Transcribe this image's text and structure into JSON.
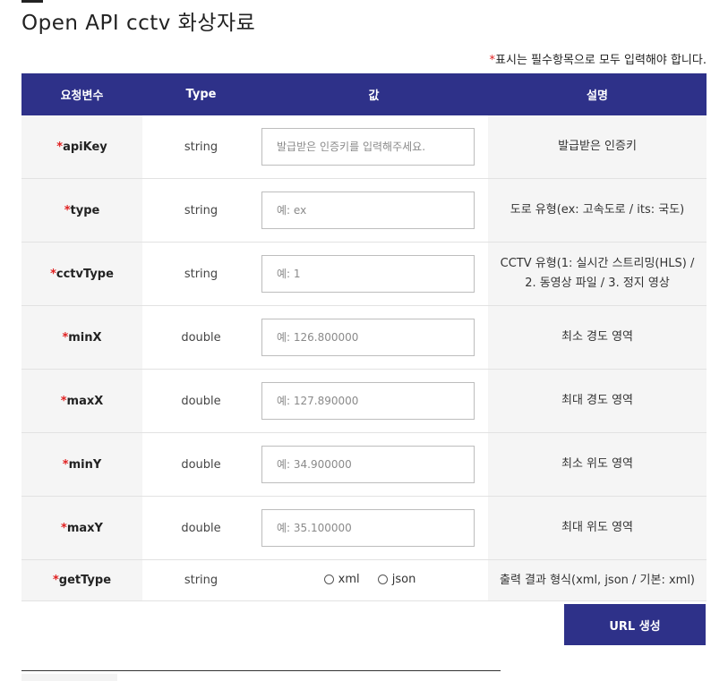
{
  "page": {
    "title": "Open  API  cctv  화상자료",
    "required_star": "*",
    "required_note": "표시는 필수항목으로 모두 입력해야 합니다."
  },
  "table": {
    "headers": [
      "요청변수",
      "Type",
      "값",
      "설명"
    ],
    "rows": [
      {
        "star": "*",
        "name": "apiKey",
        "type": "string",
        "placeholder": "발급받은 인증키를 입력해주세요.",
        "desc": "발급받은 인증키"
      },
      {
        "star": "*",
        "name": "type",
        "type": "string",
        "placeholder": "예: ex",
        "desc": "도로 유형(ex: 고속도로 / its: 국도)"
      },
      {
        "star": "*",
        "name": "cctvType",
        "type": "string",
        "placeholder": "예: 1",
        "desc": "CCTV 유형(1: 실시간 스트리밍(HLS) / 2. 동영상 파일 / 3. 정지 영상"
      },
      {
        "star": "*",
        "name": "minX",
        "type": "double",
        "placeholder": "예: 126.800000",
        "desc": "최소 경도 영역"
      },
      {
        "star": "*",
        "name": "maxX",
        "type": "double",
        "placeholder": "예: 127.890000",
        "desc": "최대 경도 영역"
      },
      {
        "star": "*",
        "name": "minY",
        "type": "double",
        "placeholder": "예: 34.900000",
        "desc": "최소 위도 영역"
      },
      {
        "star": "*",
        "name": "maxY",
        "type": "double",
        "placeholder": "예: 35.100000",
        "desc": "최대 위도 영역"
      }
    ],
    "getType": {
      "star": "*",
      "name": "getType",
      "type": "string",
      "options": [
        "xml",
        "json"
      ],
      "desc": "출력 결과 형식(xml, json / 기본: xml)"
    }
  },
  "actions": {
    "url_button": "URL 생성"
  },
  "colors": {
    "header_bg": "#2e3189",
    "required_star": "#e02020",
    "label_bg": "#f5f5f5"
  }
}
